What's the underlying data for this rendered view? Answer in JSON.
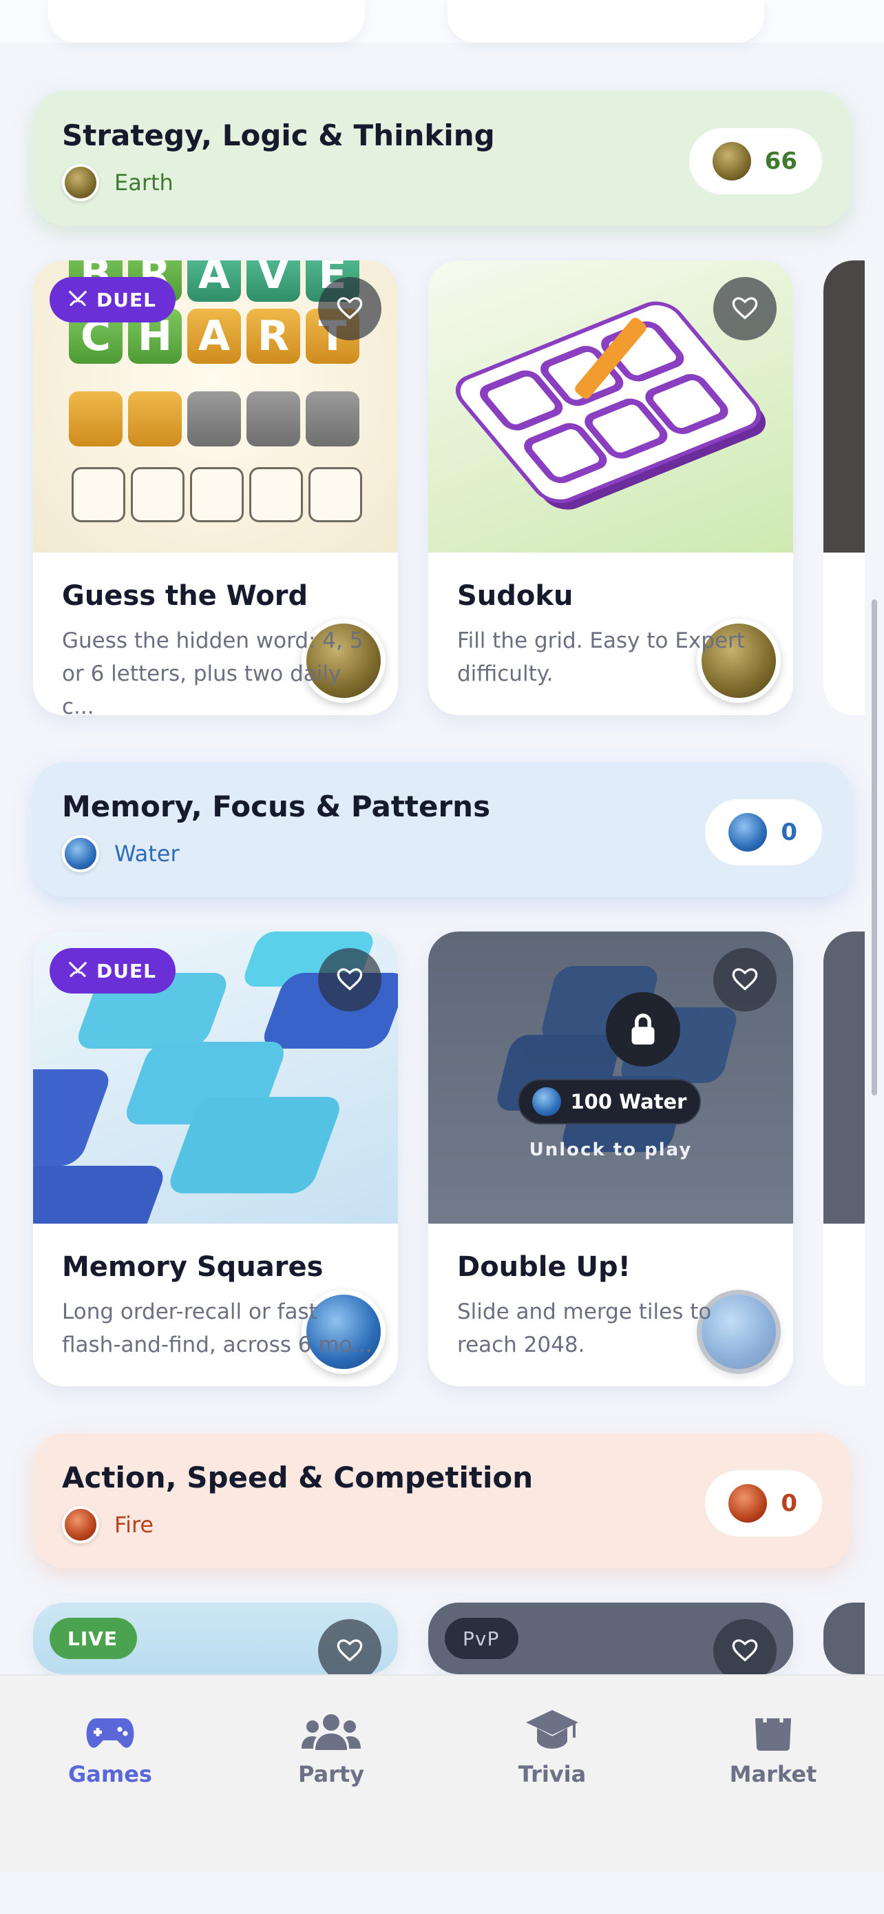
{
  "categories": [
    {
      "title": "Strategy, Logic & Thinking",
      "element": "Earth",
      "balance": "66",
      "color": "#3f7a2e"
    },
    {
      "title": "Memory, Focus & Patterns",
      "element": "Water",
      "balance": "0",
      "color": "#2c6cb8"
    },
    {
      "title": "Action, Speed & Competition",
      "element": "Fire",
      "balance": "0",
      "color": "#b8431c"
    }
  ],
  "games": {
    "guess_word": {
      "badge": "DUEL",
      "title": "Guess the Word",
      "description": "Guess the hidden word: 4, 5 or 6 letters, plus two daily c...",
      "art_row1": [
        "B",
        "R",
        "A",
        "V",
        "E"
      ],
      "art_row2": [
        "C",
        "H",
        "A",
        "R",
        "T"
      ]
    },
    "sudoku": {
      "title": "Sudoku",
      "description": "Fill the grid. Easy to Expert difficulty."
    },
    "memory_squares": {
      "badge": "DUEL",
      "title": "Memory Squares",
      "description": "Long order-recall or fast flash-and-find, across 6 mo..."
    },
    "double_up": {
      "title": "Double Up!",
      "description": "Slide and merge tiles to reach 2048.",
      "lock_cost": "100 Water",
      "lock_text": "Unlock to play"
    },
    "action1": {
      "badge": "LIVE"
    },
    "action2": {
      "badge": "PvP"
    }
  },
  "nav": [
    {
      "label": "Games",
      "icon": "gamepad-icon",
      "active": true
    },
    {
      "label": "Party",
      "icon": "users-icon",
      "active": false
    },
    {
      "label": "Trivia",
      "icon": "graduation-cap-icon",
      "active": false
    },
    {
      "label": "Market",
      "icon": "shopping-bag-icon",
      "active": false
    }
  ],
  "colors": {
    "duel": "#6a2fd6",
    "live": "#4ca34f",
    "pvp": "#2a2f3f",
    "active_nav": "#5a67d8"
  }
}
